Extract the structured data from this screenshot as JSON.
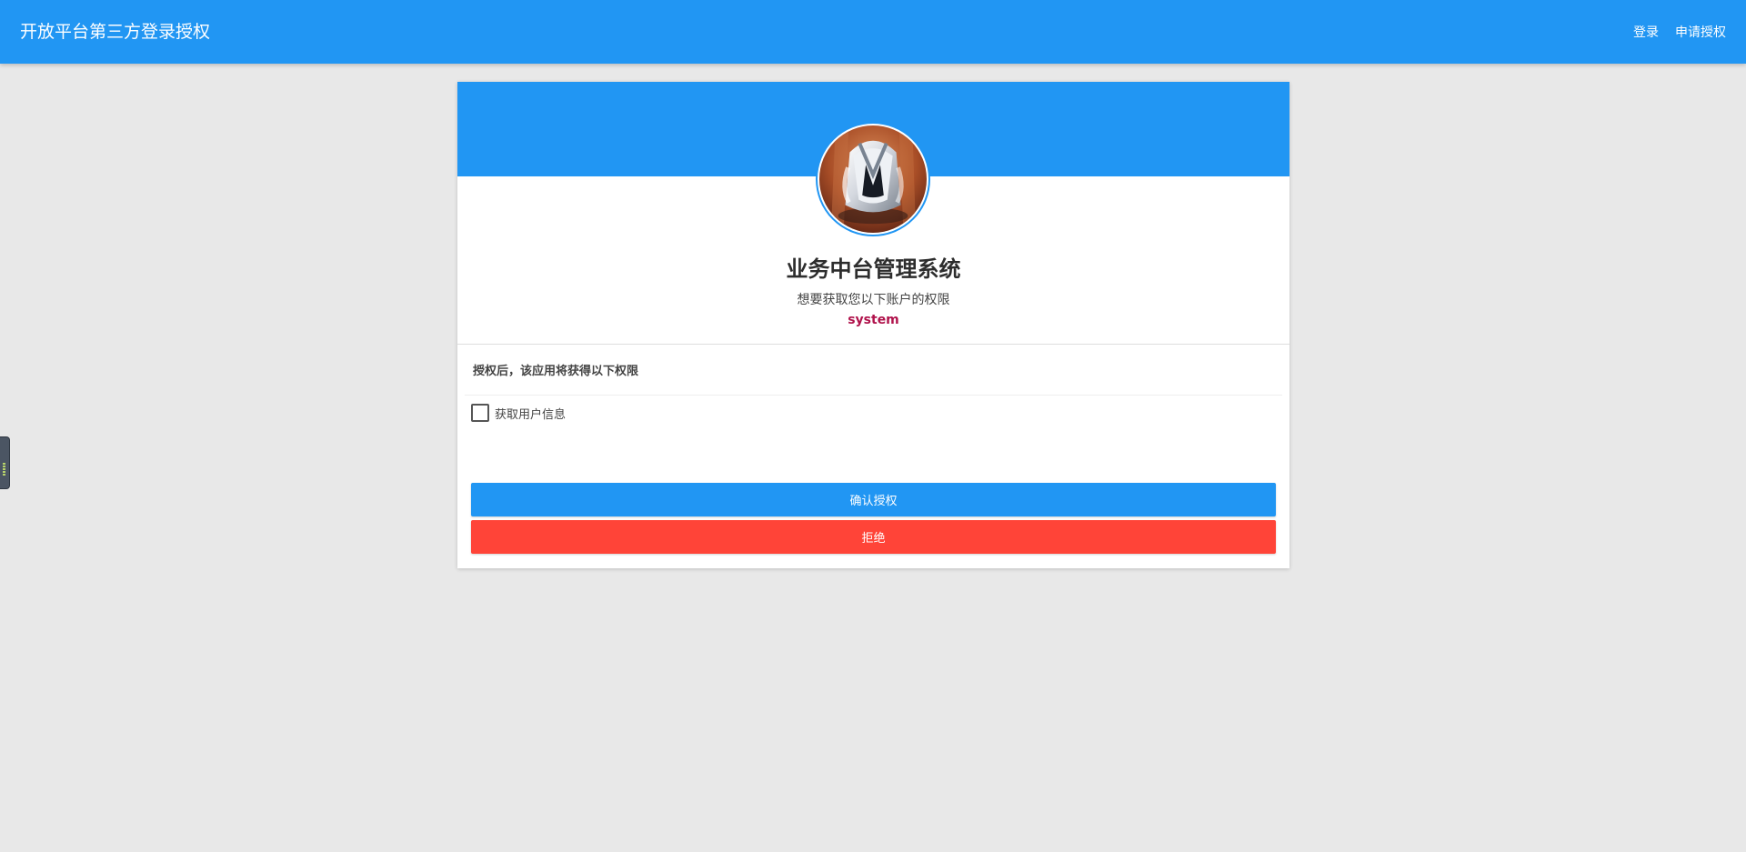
{
  "header": {
    "title": "开放平台第三方登录授权",
    "nav": {
      "login": "登录",
      "apply": "申请授权"
    }
  },
  "card": {
    "app_name": "业务中台管理系统",
    "description": "想要获取您以下账户的权限",
    "account": "system",
    "permissions_title": "授权后，该应用将获得以下权限",
    "permissions": [
      {
        "label": "获取用户信息",
        "checked": false
      }
    ],
    "buttons": {
      "confirm": "确认授权",
      "reject": "拒绝"
    }
  },
  "colors": {
    "primary": "#2196f3",
    "danger": "#ff4438",
    "account": "#b0124b",
    "background": "#e8e8e8"
  },
  "icons": {
    "avatar": "app-avatar-image"
  }
}
